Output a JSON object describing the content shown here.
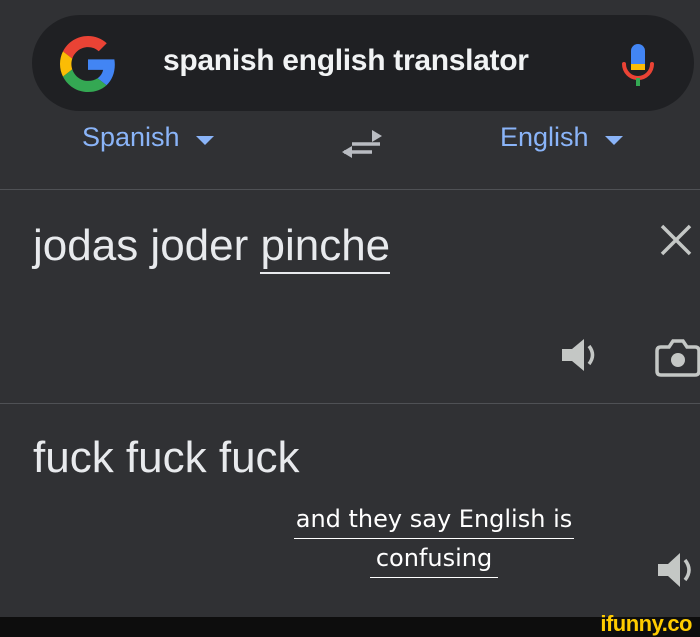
{
  "search": {
    "query": "spanish english translator"
  },
  "translator": {
    "source_lang": "Spanish",
    "target_lang": "English",
    "source_text_plain": "jodas joder ",
    "source_text_underlined": "pinche",
    "translated_text": "fuck fuck fuck"
  },
  "note": {
    "line1": "and they say English is",
    "line2": "confusing"
  },
  "watermark": "ifunny.co",
  "colors": {
    "background": "#303134",
    "link_blue": "#8ab4f8",
    "text": "#e8eaed",
    "watermark": "#ffcc00"
  },
  "icons": [
    "google-g-icon",
    "mic-icon",
    "swap-icon",
    "close-icon",
    "speaker-icon",
    "camera-icon"
  ]
}
